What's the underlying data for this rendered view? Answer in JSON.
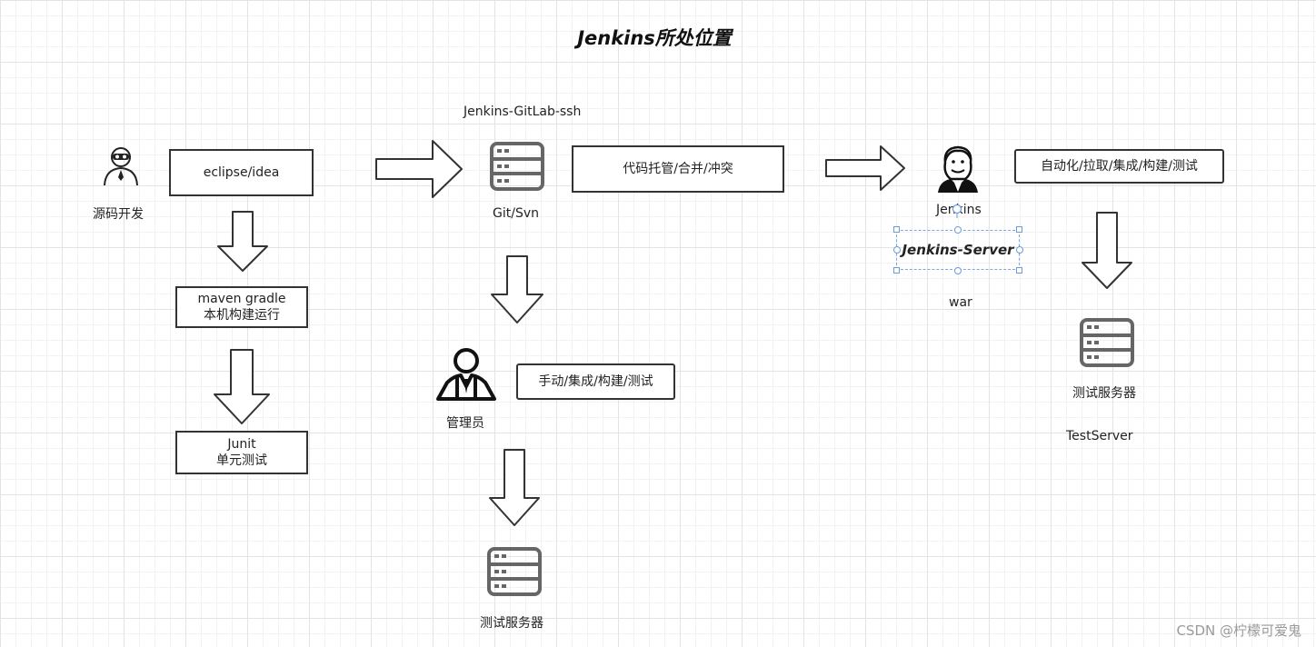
{
  "title": "Jenkins所处位置",
  "nodes": {
    "dev_label": "源码开发",
    "ide_box": "eclipse/idea",
    "build_box_line1": "maven gradle",
    "build_box_line2": "本机构建运行",
    "junit_line1": "Junit",
    "junit_line2": "单元测试",
    "gitlab_label": "Jenkins-GitLab-ssh",
    "git_label": "Git/Svn",
    "hosting_box": "代码托管/合并/冲突",
    "admin_label": "管理员",
    "manual_box": "手动/集成/构建/测试",
    "test_server_label_mid": "测试服务器",
    "jenkins_label": "Jenkins",
    "jenkins_server": "Jenkins-Server",
    "war_label": "war",
    "auto_box": "自动化/拉取/集成/构建/测试",
    "test_server_label_right": "测试服务器",
    "testserver_label": "TestServer"
  },
  "icons": {
    "developer": "developer-icon",
    "server": "server-icon",
    "admin": "admin-user-icon",
    "jenkins": "jenkins-butler-icon"
  },
  "colors": {
    "stroke": "#333333",
    "grid": "#e3e3e3",
    "selection": "#6b9bd9",
    "server_icon": "#666666"
  },
  "watermark": "CSDN @柠檬可爱鬼"
}
